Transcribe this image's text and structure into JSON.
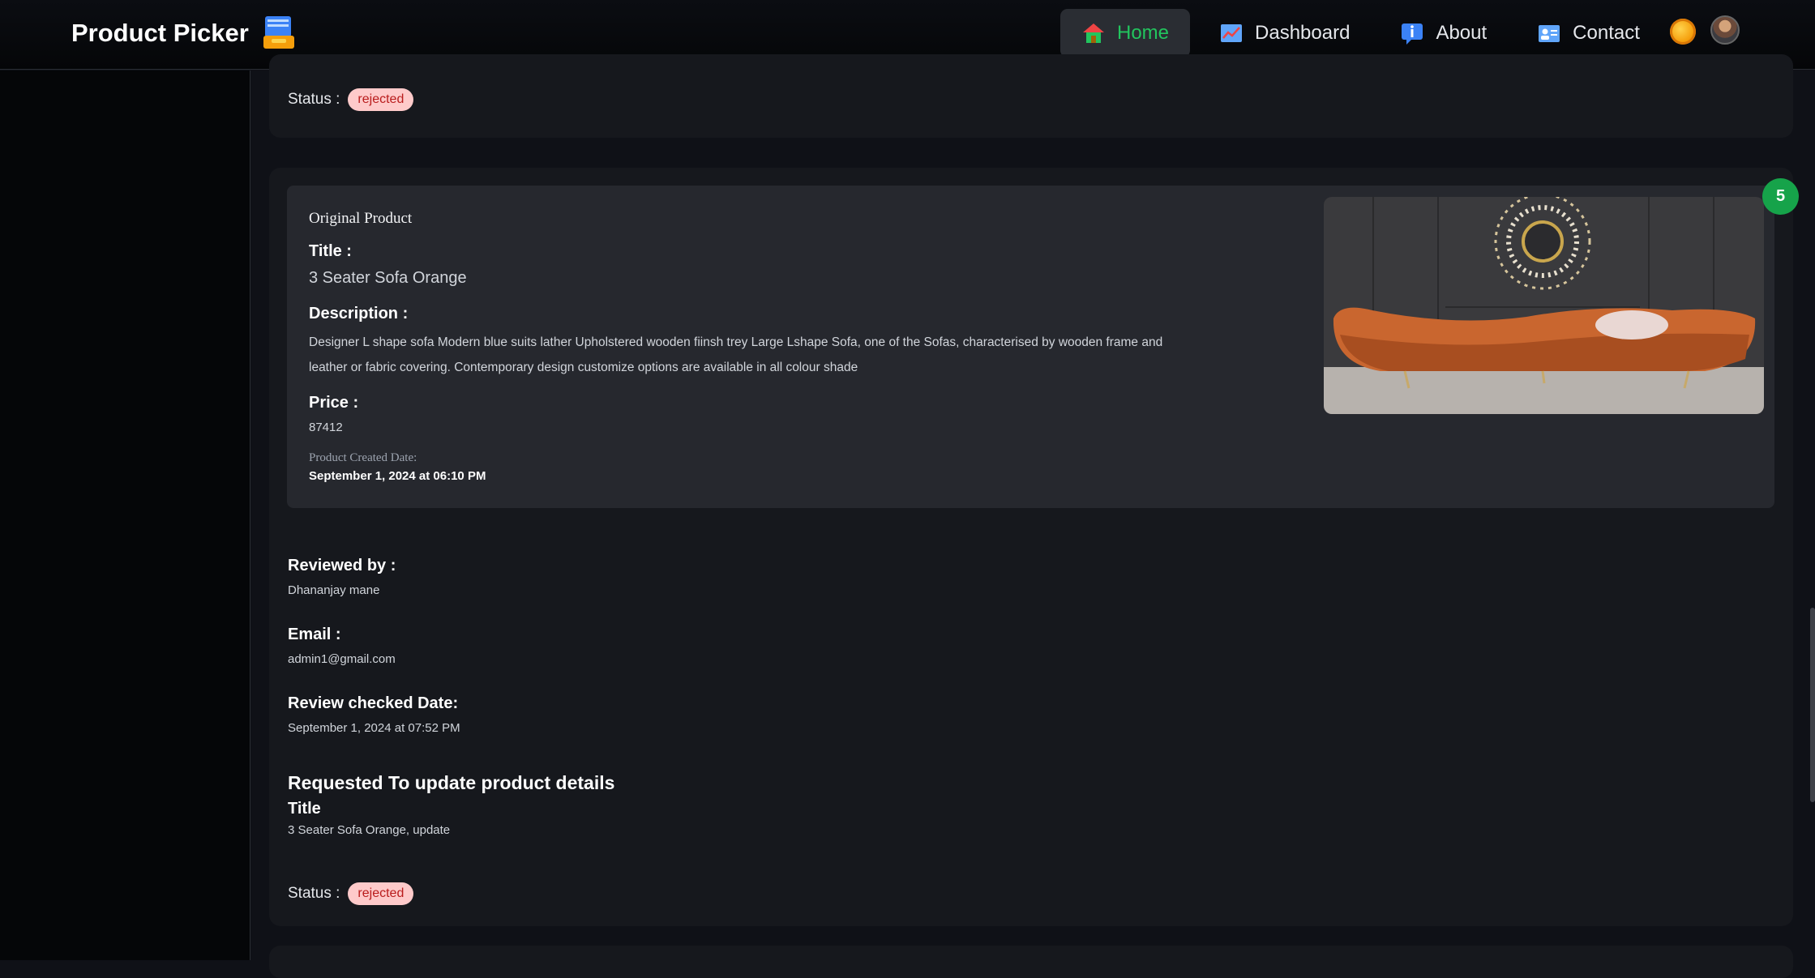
{
  "brand": {
    "name": "Product Picker"
  },
  "nav": {
    "items": [
      {
        "label": "Home",
        "active": true
      },
      {
        "label": "Dashboard",
        "active": false
      },
      {
        "label": "About",
        "active": false
      },
      {
        "label": "Contact",
        "active": false
      }
    ]
  },
  "previous_card": {
    "status_label": "Status :",
    "status": "rejected"
  },
  "card": {
    "count": "5",
    "original": {
      "section_label": "Original Product",
      "title_label": "Title :",
      "title": "3 Seater Sofa Orange",
      "description_label": "Description :",
      "description": "Designer L shape sofa Modern blue suits lather Upholstered wooden fiinsh trey Large Lshape Sofa, one of the Sofas, characterised by wooden frame and leather or fabric covering. Contemporary design customize options are available in all colour shade",
      "price_label": "Price :",
      "price": "87412",
      "created_label": "Product Created Date:",
      "created": "September 1, 2024 at 06:10 PM"
    },
    "review": {
      "reviewed_by_label": "Reviewed by :",
      "reviewed_by": "Dhananjay mane",
      "email_label": "Email :",
      "email": "admin1@gmail.com",
      "checked_label": "Review checked Date:",
      "checked": "September 1, 2024 at 07:52 PM"
    },
    "requested": {
      "heading": "Requested To update product details",
      "field_label": "Title",
      "field_value": "3 Seater Sofa Orange, update"
    },
    "status_label": "Status :",
    "status": "rejected"
  },
  "colors": {
    "accent": "#22c55e",
    "badge_bg": "#fecaca",
    "badge_text": "#b91c1c",
    "count_badge": "#16a34a"
  }
}
